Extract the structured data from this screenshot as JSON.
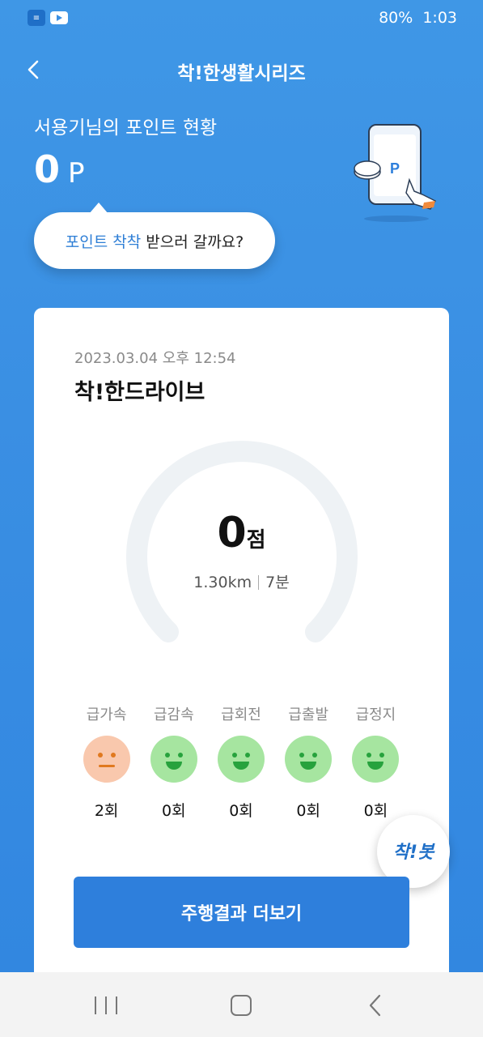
{
  "status_bar": {
    "battery": "80%",
    "time": "1:03",
    "icons": [
      "chat-app-icon",
      "youtube-icon"
    ]
  },
  "header": {
    "title": "착!한생활시리즈",
    "back_icon": "chevron-left-icon"
  },
  "points": {
    "label": "서용기님의 포인트 현황",
    "value": "0",
    "unit": "P",
    "illustration": "phone-with-point-coin-illustration"
  },
  "bubble": {
    "highlight": "포인트 착착",
    "rest": " 받으러 갈까요?"
  },
  "card": {
    "date": "2023.03.04 오후 12:54",
    "title": "착!한드라이브",
    "score": "0",
    "score_unit": "점",
    "distance": "1.30km",
    "duration": "7분",
    "events": [
      {
        "label": "급가속",
        "count": "2회",
        "face": "neutral"
      },
      {
        "label": "급감속",
        "count": "0회",
        "face": "smile"
      },
      {
        "label": "급회전",
        "count": "0회",
        "face": "smile"
      },
      {
        "label": "급출발",
        "count": "0회",
        "face": "smile"
      },
      {
        "label": "급정지",
        "count": "0회",
        "face": "smile"
      }
    ],
    "button_label": "주행결과 더보기"
  },
  "fab": {
    "label": "착!봇"
  },
  "colors": {
    "background_blue": "#3a8fe3",
    "accent_blue": "#2e7fdc",
    "good_face": "#a6e5a0",
    "bad_face": "#f9c8ad"
  },
  "nav": {
    "icons": [
      "recent-apps-icon",
      "home-icon",
      "back-icon"
    ]
  }
}
